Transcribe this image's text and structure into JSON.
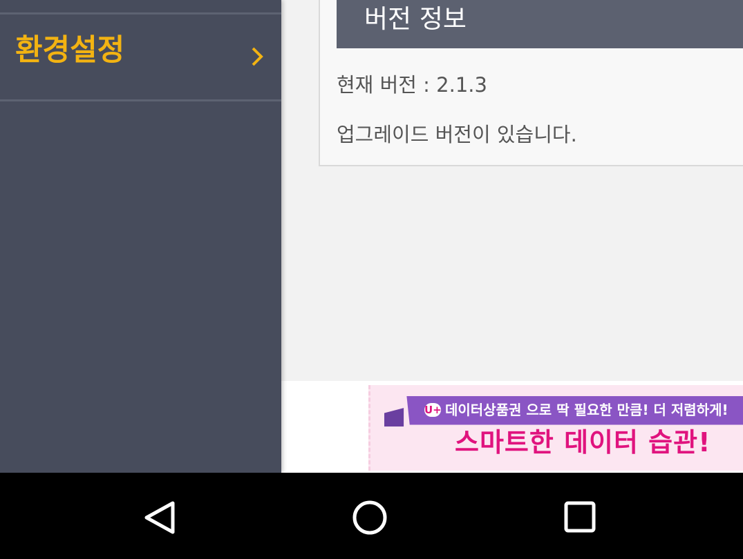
{
  "drawer": {
    "items": [
      {
        "label": "환경설정",
        "icon": "chevron-right-icon"
      }
    ],
    "colors": {
      "background": "#474c5c",
      "accent": "#f3b312"
    }
  },
  "version_panel": {
    "title": "버전 정보",
    "current_version": "현재 버전 : 2.1.3",
    "upgrade_notice": "업그레이드 버전이 있습니다."
  },
  "ad": {
    "ribbon_text": "데이터상품권 으로 딱 필요한 만큼! 더 저렴하게!",
    "logo_text": "U+",
    "headline": "스마트한 데이터 습관!",
    "colors": {
      "accent": "#e0137e",
      "background": "#fce6f1"
    }
  },
  "navbar": {
    "buttons": [
      "back-icon",
      "home-icon",
      "recent-apps-icon"
    ]
  }
}
